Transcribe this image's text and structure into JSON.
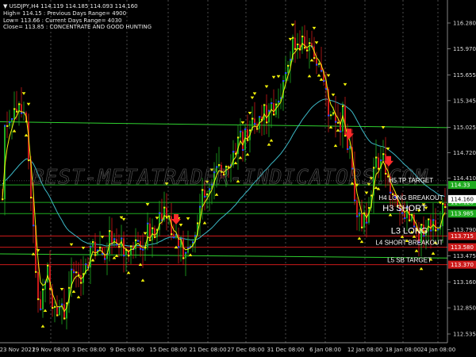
{
  "header": {
    "symbol_line": "USDJPY,H4  114.119 114.185 114.093 114.160",
    "stats": [
      "High= 114.15  :  Previous Days Range= 4900",
      "Low= 113.66  :  Current Days Range= 4030",
      "Close= 113.85 :  CONCENTRATE AND GOOD HUNTING"
    ]
  },
  "watermark": "BEST-METATRADER-INDICATORS.COM",
  "price_axis": {
    "min": 112.3,
    "max": 116.4,
    "ticks": [
      "116.280",
      "115.970",
      "115.655",
      "115.345",
      "115.025",
      "114.720",
      "114.410",
      "114.100",
      "113.790",
      "113.475",
      "113.160",
      "112.850",
      "112.535"
    ]
  },
  "time_axis": {
    "labels": [
      "23 Nov 2021",
      "29 Nov 08:00",
      "3 Dec 08:00",
      "9 Dec 08:00",
      "15 Dec 08:00",
      "21 Dec 08:00",
      "27 Dec 08:00",
      "31 Dec 08:00",
      "6 Jan 08:00",
      "12 Jan 08:00",
      "18 Jan 08:00",
      "24 Jan 08:00"
    ]
  },
  "levels": [
    {
      "name": "H5 TP TARGET",
      "label": "H5 TP TARGET",
      "price": 114.33,
      "color": "#1faa1f",
      "badge": "114.33",
      "text_size": 8
    },
    {
      "name": "H4 LONG BREAKOUT",
      "label": "H4 LONG BREAKOUT",
      "price": 114.12,
      "color": "#1faa1f",
      "badge": "114.120",
      "text_size": 8
    },
    {
      "name": "H3 SHORT",
      "label": "H3 SHORT",
      "price": 113.985,
      "color": "#1faa1f",
      "badge": "113.985",
      "text_size": 11
    },
    {
      "name": "L3 LONG",
      "label": "L3 LONG",
      "price": 113.715,
      "color": "#cc1a1a",
      "badge": "113.715",
      "text_size": 11
    },
    {
      "name": "L4 SHORT BREAKOUT",
      "label": "L4 SHORT BREAKOUT",
      "price": 113.58,
      "color": "#cc1a1a",
      "badge": "113.580",
      "text_size": 8
    },
    {
      "name": "L5 SB TARGET",
      "label": "L5 SB TARGET",
      "price": 113.37,
      "color": "#cc1a1a",
      "badge": "113.370",
      "text_size": 8
    }
  ],
  "current_price": {
    "value": "114.160",
    "price": 114.16
  },
  "indicator_colors": {
    "bull_candle": "#1faa1f",
    "bear_candle": "#cc1a1a",
    "fast_ma": "#f2f20a",
    "medium_ma": "#2a4dff",
    "slow_ma": "#3cb8c6",
    "pivot_green": "#2fd12f",
    "signal_arrow": "#ff2a2a"
  }
}
